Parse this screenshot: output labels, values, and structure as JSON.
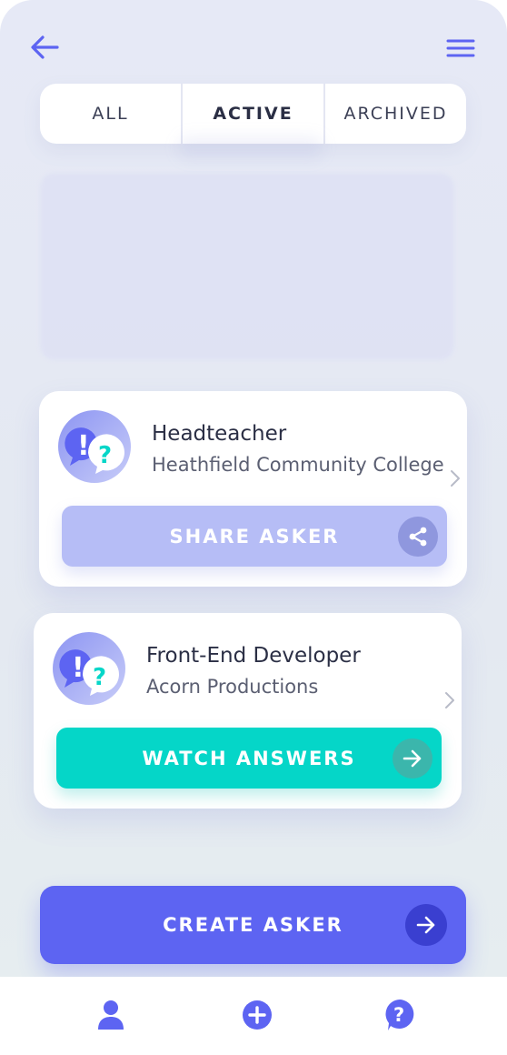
{
  "header": {
    "back_icon": "arrow-left-icon",
    "menu_icon": "hamburger-menu-icon"
  },
  "tabs": [
    {
      "label": "ALL",
      "active": false
    },
    {
      "label": "ACTIVE",
      "active": true
    },
    {
      "label": "ARCHIVED",
      "active": false
    }
  ],
  "askers": [
    {
      "title": "Headteacher",
      "subtitle": "Heathfield Community College",
      "icon": "speech-bubbles-question-icon",
      "action_label": "SHARE ASKER",
      "action_icon": "share-icon",
      "action_color": "#b6bdf6"
    },
    {
      "title": "Front-End Developer",
      "subtitle": "Acorn Productions",
      "icon": "speech-bubbles-question-icon",
      "action_label": "WATCH ANSWERS",
      "action_icon": "arrow-right-icon",
      "action_color": "#05d6c8"
    }
  ],
  "create_button": {
    "label": "CREATE ASKER",
    "icon": "arrow-right-circle-icon",
    "color": "#5d64f2"
  },
  "bottom_nav": [
    {
      "icon": "user-icon"
    },
    {
      "icon": "plus-circle-icon"
    },
    {
      "icon": "question-circle-icon"
    }
  ],
  "colors": {
    "accent": "#5d64f2",
    "teal": "#05d6c8",
    "lavender": "#b6bdf6",
    "text_dark": "#2b2f45"
  }
}
